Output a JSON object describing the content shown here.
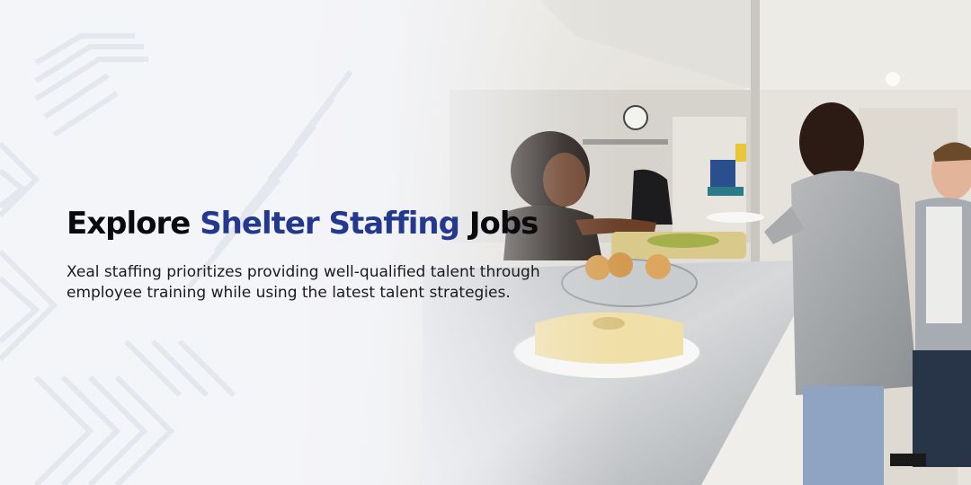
{
  "hero": {
    "headline_prefix": "Explore",
    "headline_accent": "Shelter Staffing",
    "headline_suffix": "Jobs",
    "description": "Xeal staffing prioritizes providing well-qualified talent through employee training while using the latest talent strategies."
  },
  "colors": {
    "accent": "#23398f",
    "text": "#0b0b0f",
    "background": "#f4f5f8"
  },
  "image": {
    "subject": "shelter-kitchen-serving-photo"
  }
}
